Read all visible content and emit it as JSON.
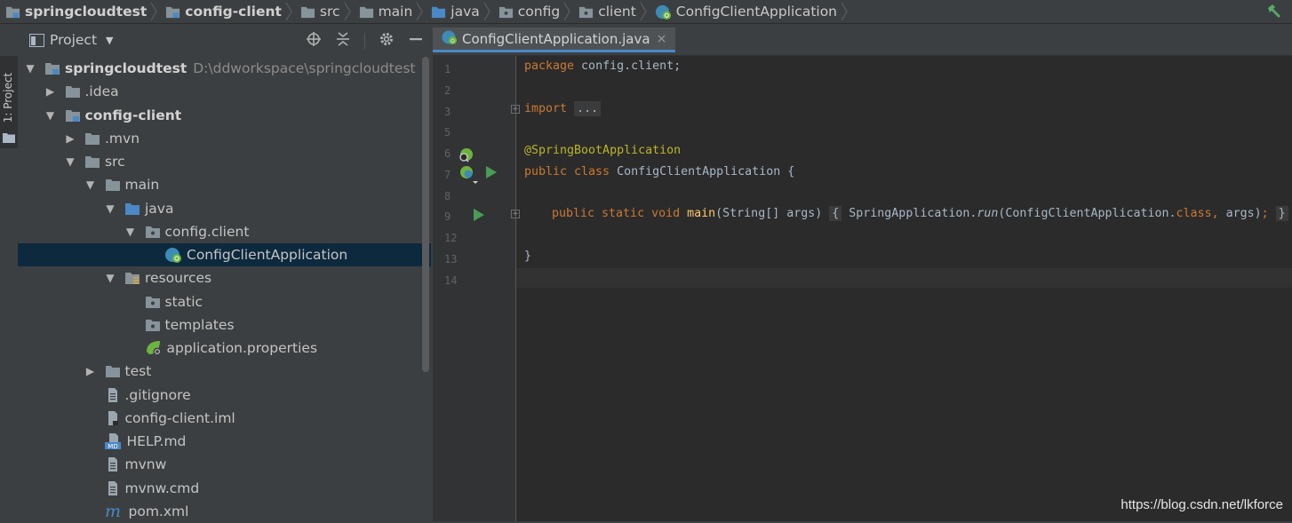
{
  "breadcrumb": [
    {
      "label": "springcloudtest",
      "icon": "module-folder-icon",
      "bold": true
    },
    {
      "label": "config-client",
      "icon": "module-folder-icon",
      "bold": true
    },
    {
      "label": "src",
      "icon": "folder-icon",
      "bold": false
    },
    {
      "label": "main",
      "icon": "folder-icon",
      "bold": false
    },
    {
      "label": "java",
      "icon": "source-folder-icon",
      "bold": false
    },
    {
      "label": "config",
      "icon": "package-icon",
      "bold": false
    },
    {
      "label": "client",
      "icon": "package-icon",
      "bold": false
    },
    {
      "label": "ConfigClientApplication",
      "icon": "spring-class-icon",
      "bold": false
    }
  ],
  "tool_stripe": {
    "project_label": "1: Project"
  },
  "project_panel": {
    "title": "Project",
    "tree": [
      {
        "name": "springcloudtest",
        "path": "D:\\ddworkspace\\springcloudtest",
        "icon": "module-folder-icon",
        "arrow": "expanded",
        "bold": true,
        "depth": 0
      },
      {
        "name": ".idea",
        "icon": "folder-icon",
        "arrow": "collapsed",
        "depth": 1
      },
      {
        "name": "config-client",
        "icon": "module-folder-icon",
        "arrow": "expanded",
        "bold": true,
        "depth": 1
      },
      {
        "name": ".mvn",
        "icon": "folder-icon",
        "arrow": "collapsed",
        "depth": 2
      },
      {
        "name": "src",
        "icon": "folder-icon",
        "arrow": "expanded",
        "depth": 2
      },
      {
        "name": "main",
        "icon": "folder-icon",
        "arrow": "expanded",
        "depth": 3
      },
      {
        "name": "java",
        "icon": "source-folder-icon",
        "arrow": "expanded",
        "depth": 4
      },
      {
        "name": "config.client",
        "icon": "package-icon",
        "arrow": "expanded",
        "depth": 5
      },
      {
        "name": "ConfigClientApplication",
        "icon": "spring-class-icon",
        "arrow": "none",
        "depth": 6,
        "selected": true
      },
      {
        "name": "resources",
        "icon": "resources-folder-icon",
        "arrow": "expanded",
        "depth": 4
      },
      {
        "name": "static",
        "icon": "package-icon",
        "arrow": "none",
        "depth": 5
      },
      {
        "name": "templates",
        "icon": "package-icon",
        "arrow": "none",
        "depth": 5
      },
      {
        "name": "application.properties",
        "icon": "spring-properties-icon",
        "arrow": "none",
        "depth": 5
      },
      {
        "name": "test",
        "icon": "folder-icon",
        "arrow": "collapsed",
        "depth": 3
      },
      {
        "name": ".gitignore",
        "icon": "text-file-icon",
        "arrow": "none",
        "depth": 3
      },
      {
        "name": "config-client.iml",
        "icon": "iml-file-icon",
        "arrow": "none",
        "depth": 3
      },
      {
        "name": "HELP.md",
        "icon": "markdown-file-icon",
        "arrow": "none",
        "depth": 3
      },
      {
        "name": "mvnw",
        "icon": "text-file-icon",
        "arrow": "none",
        "depth": 3
      },
      {
        "name": "mvnw.cmd",
        "icon": "text-file-icon",
        "arrow": "none",
        "depth": 3
      },
      {
        "name": "pom.xml",
        "icon": "maven-icon",
        "arrow": "none",
        "depth": 3
      }
    ]
  },
  "editor": {
    "tab_label": "ConfigClientApplication.java",
    "tab_close": "×",
    "line_numbers": [
      "1",
      "2",
      "3",
      "5",
      "6",
      "7",
      "8",
      "9",
      "12",
      "13",
      "14"
    ],
    "code": {
      "l1_kw": "package",
      "l1_rest": " config.client;",
      "l3_kw": "import",
      "l3_fold": "...",
      "l6_ann": "@SpringBootApplication",
      "l7_kw": "public class",
      "l7_rest": " ConfigClientApplication {",
      "l9_kw": "public static void",
      "l9_fn": "main",
      "l9_params": "(String[] args) ",
      "l9_open": "{",
      "l9_call": " SpringApplication.",
      "l9_run": "run",
      "l9_arg": "(ConfigClientApplication.",
      "l9_class_kw": "class,",
      "l9_end": " args)",
      "l9_semi": ";",
      "l9_close": "}",
      "l13": "}"
    }
  },
  "watermark": "https://blog.csdn.net/lkforce",
  "colors": {
    "keyword": "#cc7832",
    "annotation": "#bbb529",
    "method": "#ffc66d",
    "selection": "#0d293e",
    "tab_underline": "#4a88c7"
  }
}
